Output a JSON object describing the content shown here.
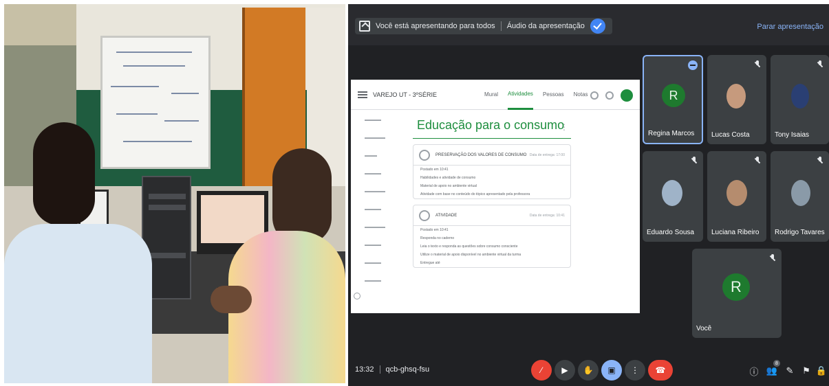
{
  "presentation_bar": {
    "status": "Você está apresentando para todos",
    "audio_label": "Áudio da apresentação",
    "stop_label": "Parar apresentação",
    "toggle_icon": "check-icon"
  },
  "classroom": {
    "course_title": "VAREJO UT - 3ºSÉRIE",
    "tabs": [
      "Mural",
      "Atividades",
      "Pessoas",
      "Notas"
    ],
    "active_tab": "Atividades",
    "topic_title": "Educação para o consumo",
    "cards": [
      {
        "title": "PRESERVAÇÃO DOS VALORES DE CONSUMO",
        "date": "Data de entrega: 17:00",
        "lines": [
          "Postado em 10:41",
          "Habilidades e atividade de consumo",
          "Material de apoio no ambiente virtual",
          "Atividade com base no conteúdo do tópico apresentado pela professora"
        ]
      },
      {
        "title": "ATIVIDADE",
        "date": "Data de entrega: 10:41",
        "lines": [
          "Postado em 10:41",
          "Responda no caderno",
          "Leia o texto e responda as questões sobre consumo consciente",
          "Utilize o material de apoio disponível no ambiente virtual da turma",
          "Entregue até"
        ]
      }
    ]
  },
  "participants": [
    {
      "name": "Regina Marcos",
      "initial": "R",
      "type": "letter",
      "speaking": true,
      "muted": false
    },
    {
      "name": "Lucas Costa",
      "initial": "",
      "type": "photo",
      "speaking": false,
      "muted": true,
      "photo_color": "#c69a7d"
    },
    {
      "name": "Tony Isaias",
      "initial": "",
      "type": "photo",
      "speaking": false,
      "muted": true,
      "photo_color": "#2a3f73"
    },
    {
      "name": "Eduardo Sousa",
      "initial": "",
      "type": "photo",
      "speaking": false,
      "muted": true,
      "photo_color": "#9fb3c8"
    },
    {
      "name": "Luciana Ribeiro",
      "initial": "",
      "type": "photo",
      "speaking": false,
      "muted": true,
      "photo_color": "#b58c6e"
    },
    {
      "name": "Rodrigo Tavares",
      "initial": "",
      "type": "photo",
      "speaking": false,
      "muted": true,
      "photo_color": "#8a9aa8"
    },
    {
      "name": "Você",
      "initial": "R",
      "type": "letter",
      "speaking": false,
      "muted": true
    }
  ],
  "bottom_bar": {
    "time": "13:32",
    "meeting_code": "qcb-ghsq-fsu",
    "controls": [
      "mic-off-icon",
      "camera-icon",
      "hand-icon",
      "present-icon",
      "more-icon",
      "hangup-icon"
    ],
    "right_icons": [
      "info-icon",
      "people-icon",
      "chat-icon",
      "activities-icon",
      "lock-icon"
    ],
    "people_count": "8"
  },
  "colors": {
    "meet_bg": "#202124",
    "accent": "#8ab4f8",
    "danger": "#ea4335",
    "classroom_green": "#1e8e3e"
  }
}
